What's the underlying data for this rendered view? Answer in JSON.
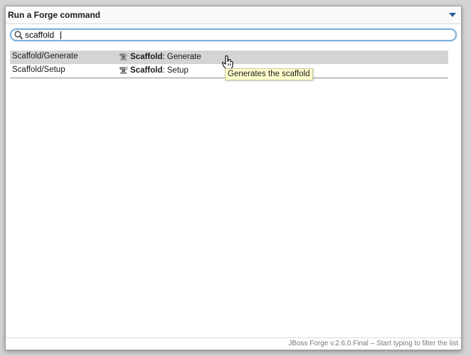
{
  "header": {
    "title": "Run a Forge command",
    "menu_icon": "chevron-down-icon"
  },
  "search": {
    "value": "scaffold",
    "icon": "search-icon"
  },
  "commands": [
    {
      "name": "Scaffold/Generate",
      "category": "Scaffold",
      "separator": ": ",
      "action": "Generate",
      "selected": true
    },
    {
      "name": "Scaffold/Setup",
      "category": "Scaffold",
      "separator": ": ",
      "action": "Setup",
      "selected": false
    }
  ],
  "tooltip": {
    "text": "Generates the scaffold"
  },
  "footer": {
    "text": "JBoss Forge v.2.6.0.Final – Start typing to filter the list"
  },
  "colors": {
    "accent": "#7fb0dc",
    "selected_row": "#d4d4d4",
    "tooltip_bg": "#ffffcc"
  }
}
